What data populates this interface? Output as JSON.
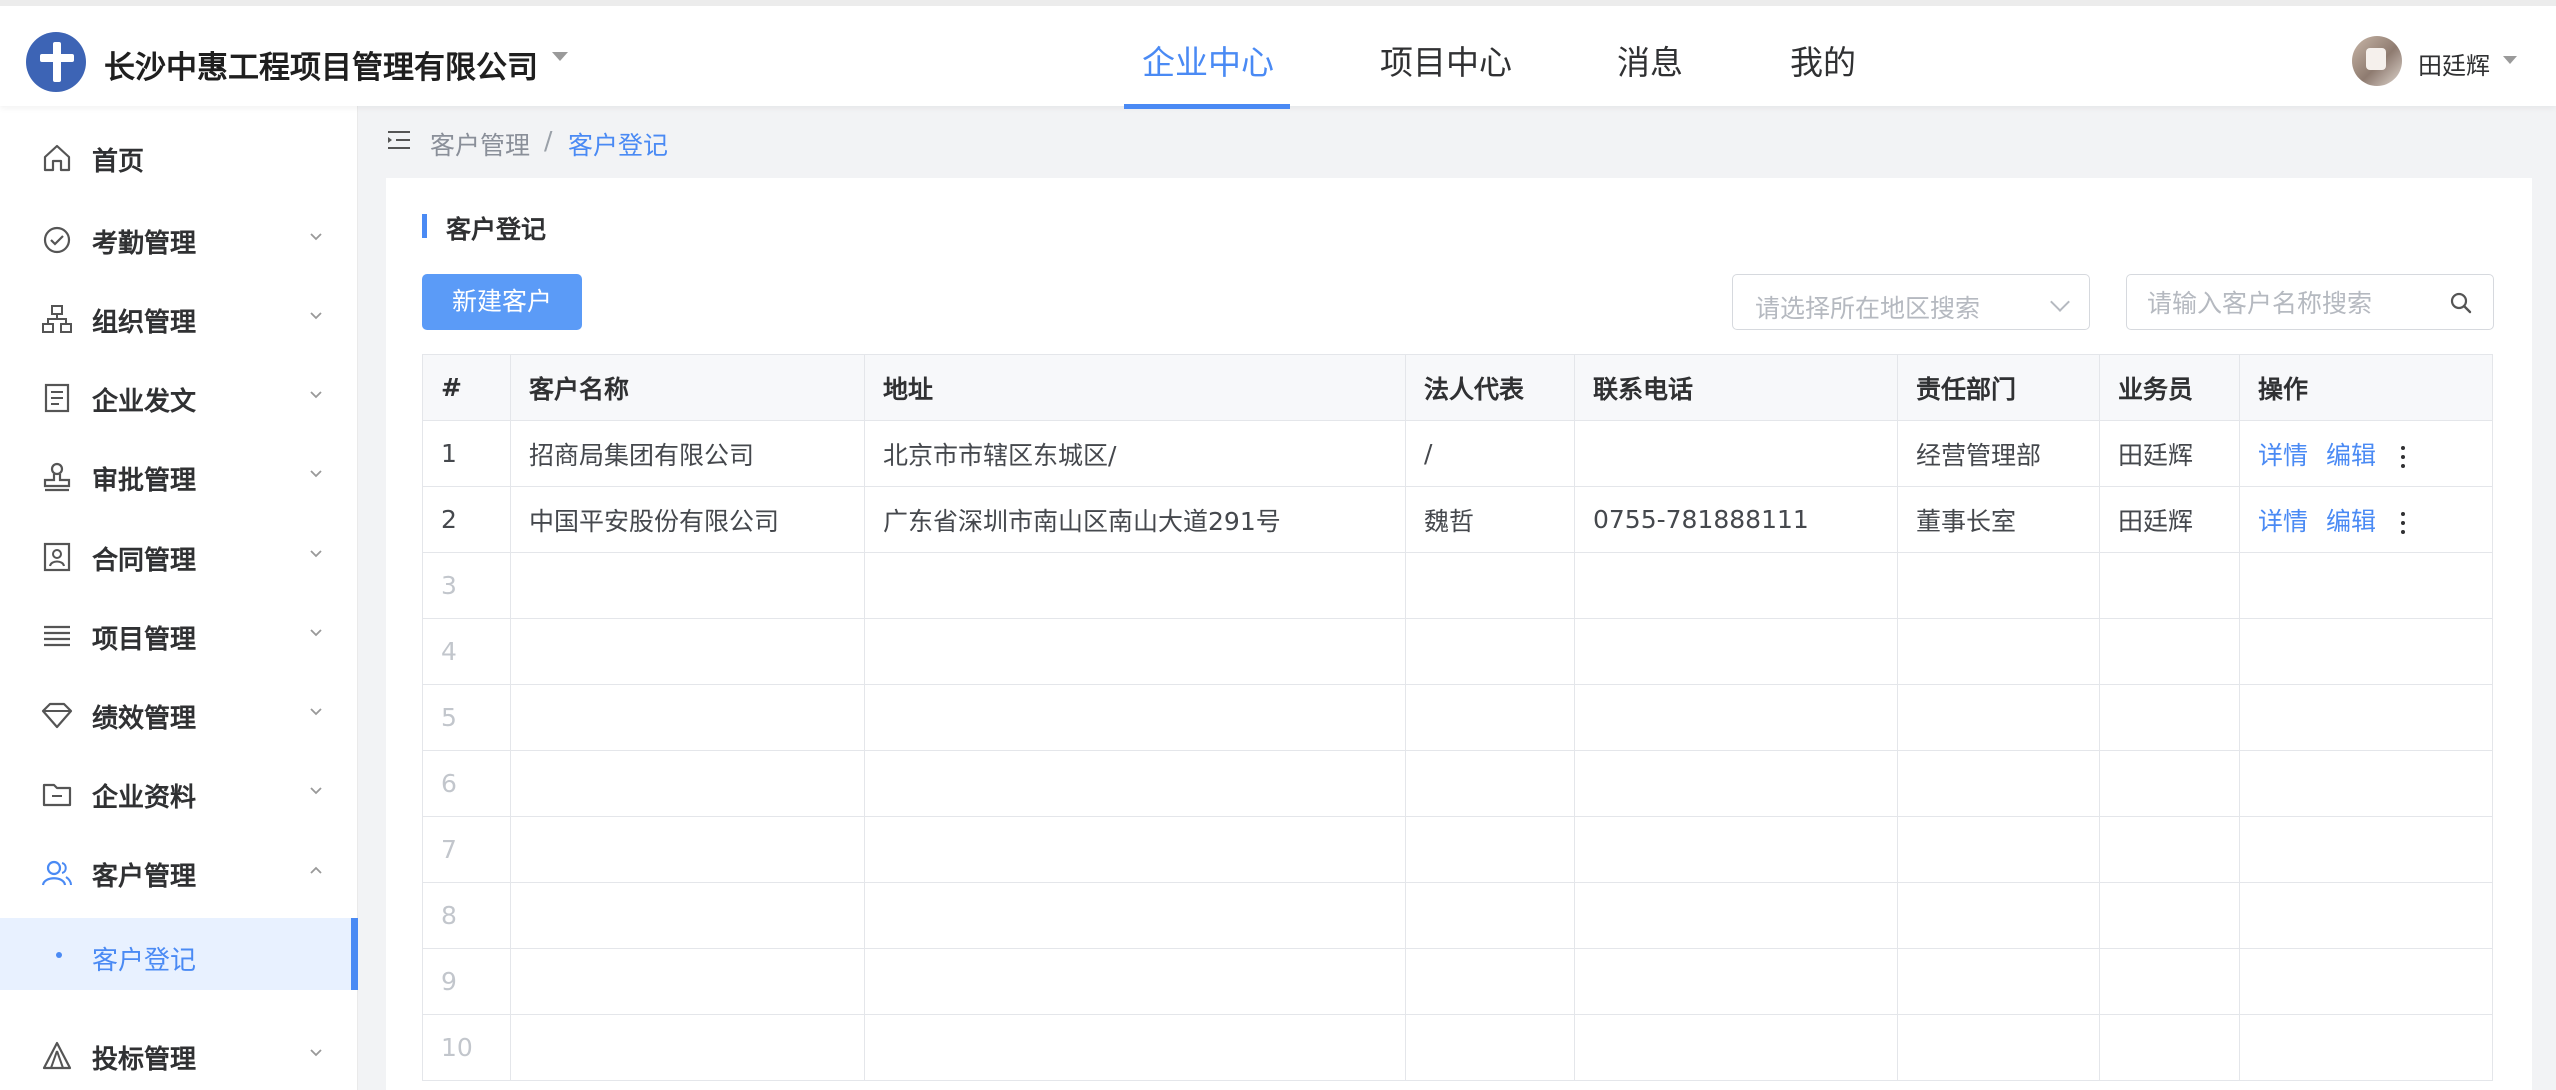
{
  "header": {
    "company": "长沙中惠工程项目管理有限公司",
    "tabs": [
      {
        "label": "企业中心",
        "active": true
      },
      {
        "label": "项目中心",
        "active": false
      },
      {
        "label": "消息",
        "active": false
      },
      {
        "label": "我的",
        "active": false
      }
    ],
    "user": {
      "name": "田廷辉"
    }
  },
  "sidebar": {
    "items": [
      {
        "label": "首页",
        "icon": "home-icon"
      },
      {
        "label": "考勤管理",
        "icon": "check-circle-icon"
      },
      {
        "label": "组织管理",
        "icon": "org-chart-icon"
      },
      {
        "label": "企业发文",
        "icon": "document-icon"
      },
      {
        "label": "审批管理",
        "icon": "stamp-icon"
      },
      {
        "label": "合同管理",
        "icon": "contract-icon"
      },
      {
        "label": "项目管理",
        "icon": "list-icon"
      },
      {
        "label": "绩效管理",
        "icon": "diamond-icon"
      },
      {
        "label": "企业资料",
        "icon": "folder-icon"
      },
      {
        "label": "客户管理",
        "icon": "users-icon"
      },
      {
        "label": "投标管理",
        "icon": "bid-icon"
      }
    ],
    "active_sub": {
      "label": "客户登记"
    },
    "accent_color": "#4a8af4"
  },
  "breadcrumb": {
    "items": [
      "客户管理",
      "客户登记"
    ],
    "separator": "/"
  },
  "page": {
    "title": "客户登记",
    "new_button": "新建客户",
    "region_placeholder": "请选择所在地区搜索",
    "search_placeholder": "请输入客户名称搜索"
  },
  "table": {
    "columns": [
      "#",
      "客户名称",
      "地址",
      "法人代表",
      "联系电话",
      "责任部门",
      "业务员",
      "操作"
    ],
    "rows": [
      {
        "idx": "1",
        "name": "招商局集团有限公司",
        "address": "北京市市辖区东城区/",
        "legal": "/",
        "phone": "",
        "dept": "经营管理部",
        "sales": "田廷辉",
        "detail": "详情",
        "edit": "编辑"
      },
      {
        "idx": "2",
        "name": "中国平安股份有限公司",
        "address": "广东省深圳市南山区南山大道291号",
        "legal": "魏哲",
        "phone": "0755-781888111",
        "dept": "董事长室",
        "sales": "田廷辉",
        "detail": "详情",
        "edit": "编辑"
      }
    ],
    "empty_rows": [
      "3",
      "4",
      "5",
      "6",
      "7",
      "8",
      "9",
      "10"
    ]
  }
}
